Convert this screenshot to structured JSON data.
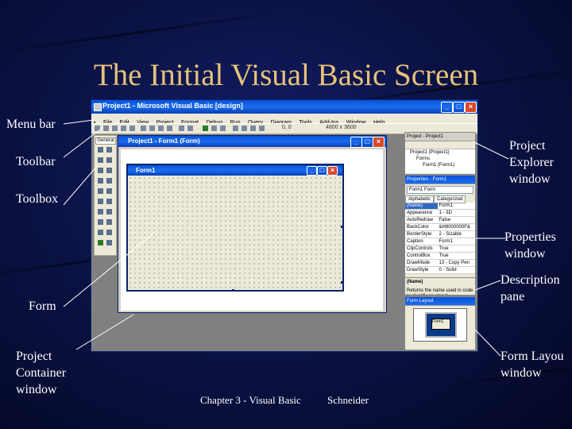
{
  "slide": {
    "title": "The Initial Visual Basic Screen",
    "footer_left": "Chapter 3 - Visual Basic",
    "footer_right": "Schneider"
  },
  "callouts": {
    "menu_bar": "Menu bar",
    "toolbar": "Toolbar",
    "toolbox": "Toolbox",
    "form": "Form",
    "project_container": [
      "Project",
      "Container",
      "window"
    ],
    "project_explorer": [
      "Project",
      "Explorer",
      "window"
    ],
    "properties": [
      "Properties",
      "window"
    ],
    "description": [
      "Description",
      "pane"
    ],
    "form_layout": [
      "Form Layou",
      "window"
    ]
  },
  "vb": {
    "window_title": "Project1 - Microsoft Visual Basic [design]",
    "menu": [
      "File",
      "Edit",
      "View",
      "Project",
      "Format",
      "Debug",
      "Run",
      "Query",
      "Diagram",
      "Tools",
      "Add-Ins",
      "Window",
      "Help"
    ],
    "toolbar_coords_1": "0, 0",
    "toolbar_coords_2": "4800 x 3600",
    "toolbox_tab": "General",
    "container_title": "Project1 - Form1 (Form)",
    "form_title": "Form1",
    "project_panel": {
      "title": "Project - Project1",
      "tree": [
        "Project1 (Project1)",
        "Forms",
        "Form1 (Form1)"
      ]
    },
    "properties_panel": {
      "title": "Properties - Form1",
      "object": "Form1 Form",
      "tabs": [
        "Alphabetic",
        "Categorized"
      ],
      "rows": [
        [
          "(Name)",
          "Form1"
        ],
        [
          "Appearance",
          "1 - 3D"
        ],
        [
          "AutoRedraw",
          "False"
        ],
        [
          "BackColor",
          "&H8000000F&"
        ],
        [
          "BorderStyle",
          "2 - Sizable"
        ],
        [
          "Caption",
          "Form1"
        ],
        [
          "ClipControls",
          "True"
        ],
        [
          "ControlBox",
          "True"
        ],
        [
          "DrawMode",
          "13 - Copy Pen"
        ],
        [
          "DrawStyle",
          "0 - Solid"
        ]
      ],
      "desc_title": "(Name)",
      "desc_text": "Returns the name used in code to identify an object."
    },
    "layout_panel": {
      "title": "Form Layout",
      "mini_form": "Form1"
    }
  },
  "colors": {
    "title": "#e6c27a",
    "xp_title_bar": "#1a6cf0",
    "background": "#0b1347"
  }
}
